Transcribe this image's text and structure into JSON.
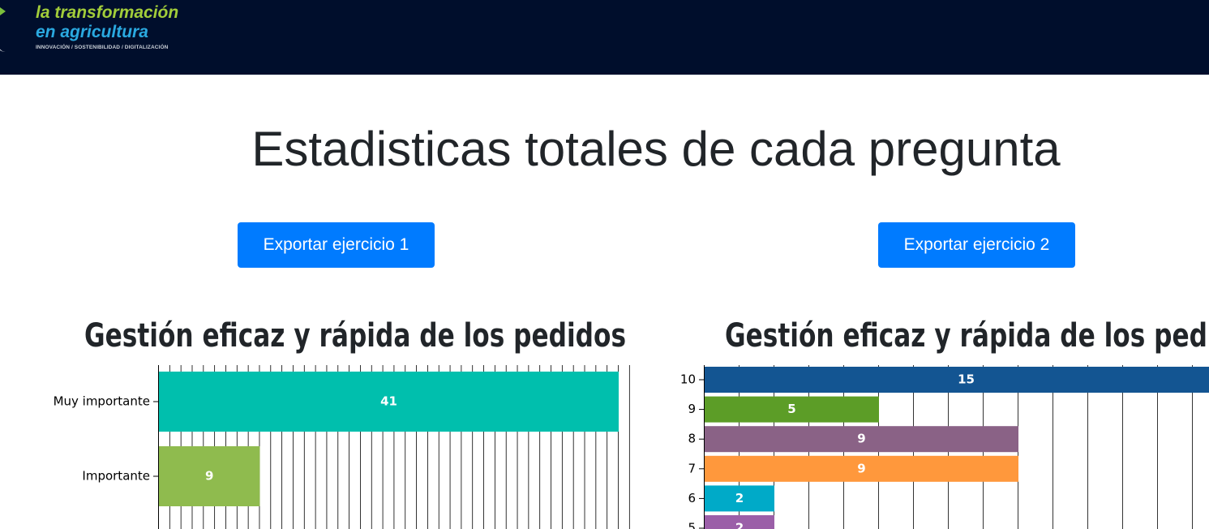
{
  "navbar": {
    "logo": {
      "line1": "la transformación",
      "line2": "en agricultura",
      "tagline": "INNOVACIÓN / SOSTENIBILIDAD / DIGITALIZACIÓN",
      "colors": {
        "line1": "#a2cd3a",
        "line2": "#2aa9e0",
        "background": "#000e2c"
      }
    }
  },
  "page": {
    "title": "Estadisticas totales de cada pregunta"
  },
  "buttons": {
    "export1": "Exportar ejercicio 1",
    "export2": "Exportar ejercicio 2",
    "color": "#007bff"
  },
  "chart_data": [
    {
      "type": "bar",
      "orientation": "horizontal",
      "title": "Gestión eficaz y rápida de los pedidos",
      "categories": [
        "Muy importante",
        "Importante"
      ],
      "values": [
        41,
        9
      ],
      "colors": [
        "#00bfad",
        "#8fbb4e"
      ],
      "xlim": [
        0,
        42
      ],
      "grid": true,
      "legend": "none"
    },
    {
      "type": "bar",
      "orientation": "horizontal",
      "title": "Gestión eficaz y rápida de los pedidos",
      "categories": [
        "10",
        "9",
        "8",
        "7",
        "6",
        "5"
      ],
      "values": [
        15,
        5,
        9,
        9,
        2,
        2
      ],
      "colors": [
        "#135592",
        "#5c9d27",
        "#8a6286",
        "#ff983c",
        "#00aac8",
        "#9b5fa8"
      ],
      "xlim": [
        0,
        15
      ],
      "grid": true,
      "legend": "none"
    }
  ]
}
